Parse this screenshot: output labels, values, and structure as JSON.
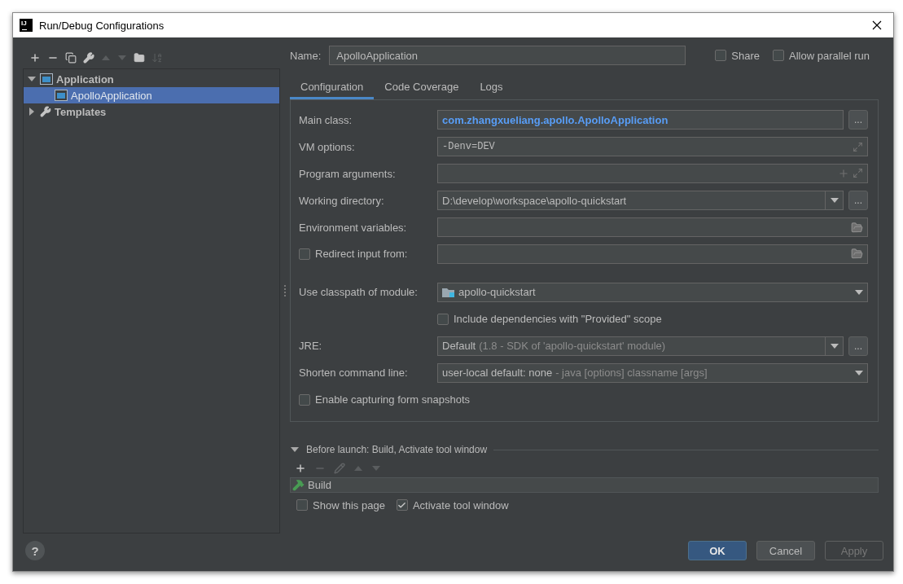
{
  "window": {
    "title": "Run/Debug Configurations",
    "logo_text": "IJ",
    "help": "?"
  },
  "toolbar": [
    {
      "kind": "add",
      "disabled": false
    },
    {
      "kind": "remove",
      "disabled": false
    },
    {
      "kind": "copy",
      "disabled": false
    },
    {
      "kind": "wrench",
      "disabled": false
    },
    {
      "kind": "up",
      "disabled": true
    },
    {
      "kind": "down",
      "disabled": true
    },
    {
      "kind": "folder",
      "disabled": false
    },
    {
      "kind": "sort",
      "disabled": true
    }
  ],
  "tree": [
    {
      "label": "Application",
      "kind": "application",
      "expanded": true,
      "selected": false,
      "children": [
        {
          "label": "ApolloApplication",
          "kind": "application",
          "selected": true
        }
      ]
    },
    {
      "label": "Templates",
      "kind": "templates",
      "expanded": false,
      "selected": false
    }
  ],
  "name": {
    "label": "Name:",
    "value": "ApolloApplication"
  },
  "options": [
    {
      "label": "Share",
      "checked": false
    },
    {
      "label": "Allow parallel run",
      "checked": false
    }
  ],
  "tabs": [
    {
      "label": "Configuration",
      "selected": true
    },
    {
      "label": "Code Coverage",
      "selected": false
    },
    {
      "label": "Logs",
      "selected": false
    }
  ],
  "fields": [
    {
      "kind": "class",
      "label": "Main class:",
      "value": "com.zhangxueliang.apollo.ApolloApplication",
      "button": "..."
    },
    {
      "kind": "vm",
      "label": "VM options:",
      "value": "-Denv=DEV"
    },
    {
      "kind": "arguments",
      "label": "Program arguments:"
    },
    {
      "kind": "combo",
      "label": "Working directory:",
      "value": "D:\\develop\\workspace\\apollo-quickstart",
      "button": "..."
    },
    {
      "kind": "folder",
      "label": "Environment variables:"
    },
    {
      "kind": "folder",
      "label": "Redirect input from:",
      "checked": false
    },
    {
      "kind": "gap"
    },
    {
      "kind": "module",
      "label": "Use classpath of module:",
      "value": "apollo-quickstart"
    },
    {
      "kind": "checkbox",
      "label": "Include dependencies with \"Provided\" scope",
      "checked": false
    },
    {
      "kind": "combo",
      "label": "JRE:",
      "value": "Default",
      "hint": "(1.8 - SDK of 'apollo-quickstart' module)",
      "button": "..."
    },
    {
      "kind": "dropdown",
      "label": "Shorten command line:",
      "value": "user-local default: none",
      "hint": "- java [options] classname [args]"
    },
    {
      "kind": "option",
      "label": "Enable capturing form snapshots",
      "checked": false
    }
  ],
  "before_launch": {
    "title": "Before launch: Build, Activate tool window",
    "expanded": true,
    "toolbar": [
      {
        "kind": "add",
        "disabled": false
      },
      {
        "kind": "remove",
        "disabled": true
      },
      {
        "kind": "edit",
        "disabled": true
      },
      {
        "kind": "up",
        "disabled": true
      },
      {
        "kind": "down",
        "disabled": true
      }
    ],
    "tasks": [
      {
        "label": "Build",
        "kind": "build"
      }
    ],
    "options": [
      {
        "label": "Show this page",
        "checked": false
      },
      {
        "label": "Activate tool window",
        "checked": true
      }
    ]
  },
  "buttons": [
    {
      "label": "OK",
      "default": true,
      "disabled": false
    },
    {
      "label": "Cancel",
      "default": false,
      "disabled": false
    },
    {
      "label": "Apply",
      "default": false,
      "disabled": true
    }
  ]
}
